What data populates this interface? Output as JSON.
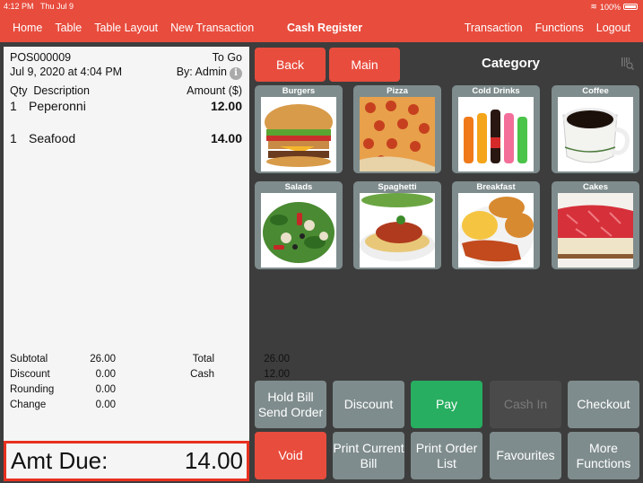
{
  "status_bar": {
    "time": "4:12 PM",
    "date": "Thu Jul 9",
    "battery": "100%"
  },
  "nav": {
    "left": [
      "Home",
      "Table",
      "Table Layout",
      "New Transaction"
    ],
    "title": "Cash Register",
    "right": [
      "Transaction",
      "Functions",
      "Logout"
    ]
  },
  "receipt": {
    "order_no": "POS000009",
    "order_type": "To Go",
    "datetime": "Jul 9, 2020 at 4:04 PM",
    "by": "By: Admin",
    "headers": {
      "qty": "Qty",
      "description": "Description",
      "amount": "Amount ($)"
    },
    "items": [
      {
        "qty": "1",
        "description": "Peperonni",
        "amount": "12.00"
      },
      {
        "qty": "1",
        "description": "Seafood",
        "amount": "14.00"
      }
    ],
    "totals": {
      "subtotal_label": "Subtotal",
      "subtotal": "26.00",
      "discount_label": "Discount",
      "discount": "0.00",
      "rounding_label": "Rounding",
      "rounding": "0.00",
      "change_label": "Change",
      "change": "0.00",
      "total_label": "Total",
      "total": "26.00",
      "cash_label": "Cash",
      "cash": "12.00"
    },
    "amt_due_label": "Amt Due:",
    "amt_due": "14.00"
  },
  "panel": {
    "back": "Back",
    "main": "Main",
    "title": "Category",
    "categories": [
      "Burgers",
      "Pizza",
      "Cold Drinks",
      "Coffee",
      "Salads",
      "Spaghetti",
      "Breakfast",
      "Cakes"
    ]
  },
  "actions": {
    "hold_bill": "Hold Bill Send Order",
    "discount": "Discount",
    "pay": "Pay",
    "cash_in": "Cash In",
    "checkout": "Checkout",
    "void": "Void",
    "print_bill": "Print Current Bill",
    "print_order": "Print Order List",
    "favourites": "Favourites",
    "more": "More Functions"
  },
  "colors": {
    "accent": "#e84c3d",
    "pay": "#27ae60",
    "button": "#7f8c8d",
    "disabled": "#4a4a4a"
  }
}
